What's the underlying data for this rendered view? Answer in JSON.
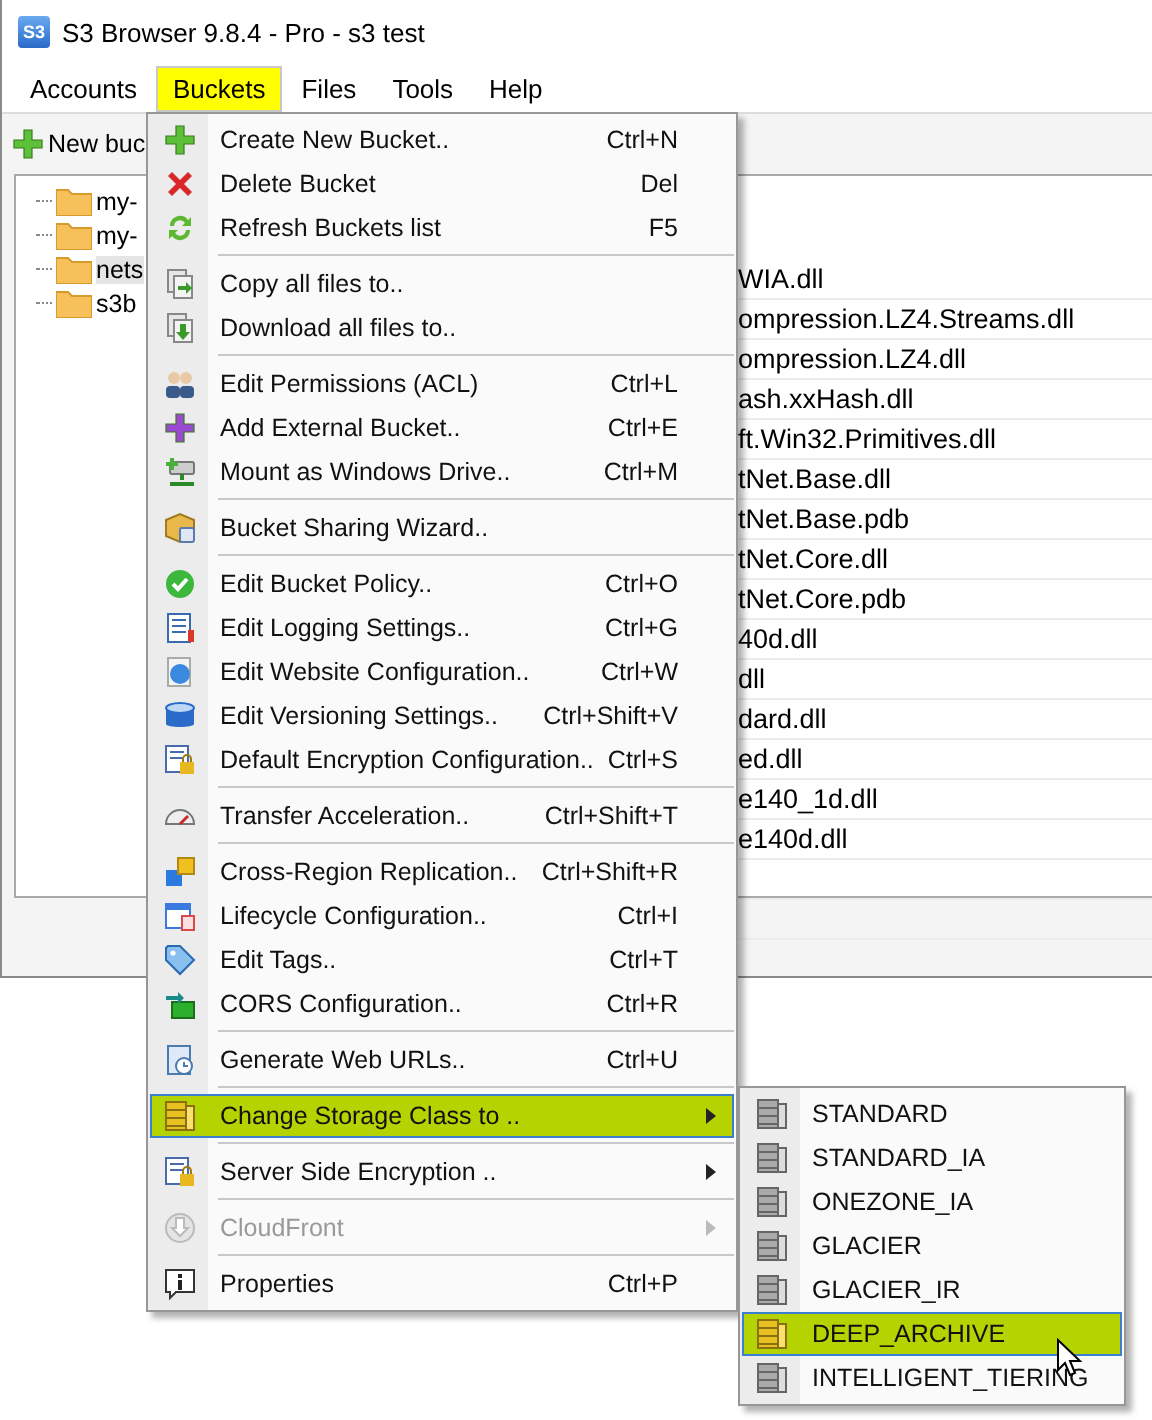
{
  "window": {
    "title": "S3 Browser 9.8.4 - Pro - s3 test",
    "app_icon_text": "S3"
  },
  "menu_bar": [
    {
      "label": "Accounts",
      "selected": false
    },
    {
      "label": "Buckets",
      "selected": true
    },
    {
      "label": "Files",
      "selected": false
    },
    {
      "label": "Tools",
      "selected": false
    },
    {
      "label": "Help",
      "selected": false
    }
  ],
  "toolbar": [
    {
      "label": "New buc"
    }
  ],
  "bucket_tree": [
    {
      "label": "my-",
      "selected": false
    },
    {
      "label": "my-",
      "selected": false
    },
    {
      "label": "nets",
      "selected": true
    },
    {
      "label": "s3b",
      "selected": false
    }
  ],
  "file_list": [
    "WIA.dll",
    "ompression.LZ4.Streams.dll",
    "ompression.LZ4.dll",
    "ash.xxHash.dll",
    "ft.Win32.Primitives.dll",
    "tNet.Base.dll",
    "tNet.Base.pdb",
    "tNet.Core.dll",
    "tNet.Core.pdb",
    "40d.dll",
    "dll",
    "dard.dll",
    "ed.dll",
    "e140_1d.dll",
    "e140d.dll"
  ],
  "buckets_menu": [
    {
      "kind": "item",
      "label": "Create New Bucket..",
      "shortcut": "Ctrl+N",
      "submenu": false,
      "disabled": false,
      "selected": false
    },
    {
      "kind": "item",
      "label": "Delete Bucket",
      "shortcut": "Del",
      "submenu": false,
      "disabled": false,
      "selected": false
    },
    {
      "kind": "item",
      "label": "Refresh Buckets list",
      "shortcut": "F5",
      "submenu": false,
      "disabled": false,
      "selected": false
    },
    {
      "kind": "separator"
    },
    {
      "kind": "item",
      "label": "Copy all files to..",
      "submenu": false,
      "disabled": false,
      "selected": false
    },
    {
      "kind": "item",
      "label": "Download all files to..",
      "submenu": false,
      "disabled": false,
      "selected": false
    },
    {
      "kind": "separator"
    },
    {
      "kind": "item",
      "label": "Edit Permissions (ACL)",
      "shortcut": "Ctrl+L",
      "submenu": false,
      "disabled": false,
      "selected": false
    },
    {
      "kind": "item",
      "label": "Add External Bucket..",
      "shortcut": "Ctrl+E",
      "submenu": false,
      "disabled": false,
      "selected": false
    },
    {
      "kind": "item",
      "label": "Mount as Windows Drive..",
      "shortcut": "Ctrl+M",
      "submenu": false,
      "disabled": false,
      "selected": false
    },
    {
      "kind": "separator"
    },
    {
      "kind": "item",
      "label": "Bucket Sharing Wizard..",
      "submenu": false,
      "disabled": false,
      "selected": false
    },
    {
      "kind": "separator"
    },
    {
      "kind": "item",
      "label": "Edit Bucket Policy..",
      "shortcut": "Ctrl+O",
      "submenu": false,
      "disabled": false,
      "selected": false
    },
    {
      "kind": "item",
      "label": "Edit Logging Settings..",
      "shortcut": "Ctrl+G",
      "submenu": false,
      "disabled": false,
      "selected": false
    },
    {
      "kind": "item",
      "label": "Edit Website Configuration..",
      "shortcut": "Ctrl+W",
      "submenu": false,
      "disabled": false,
      "selected": false
    },
    {
      "kind": "item",
      "label": "Edit Versioning Settings..",
      "shortcut": "Ctrl+Shift+V",
      "submenu": false,
      "disabled": false,
      "selected": false
    },
    {
      "kind": "item",
      "label": "Default Encryption Configuration..",
      "shortcut": "Ctrl+S",
      "submenu": false,
      "disabled": false,
      "selected": false
    },
    {
      "kind": "separator"
    },
    {
      "kind": "item",
      "label": "Transfer Acceleration..",
      "shortcut": "Ctrl+Shift+T",
      "submenu": false,
      "disabled": false,
      "selected": false
    },
    {
      "kind": "separator"
    },
    {
      "kind": "item",
      "label": "Cross-Region Replication..",
      "shortcut": "Ctrl+Shift+R",
      "submenu": false,
      "disabled": false,
      "selected": false
    },
    {
      "kind": "item",
      "label": "Lifecycle Configuration..",
      "shortcut": "Ctrl+I",
      "submenu": false,
      "disabled": false,
      "selected": false
    },
    {
      "kind": "item",
      "label": "Edit Tags..",
      "shortcut": "Ctrl+T",
      "submenu": false,
      "disabled": false,
      "selected": false
    },
    {
      "kind": "item",
      "label": "CORS Configuration..",
      "shortcut": "Ctrl+R",
      "submenu": false,
      "disabled": false,
      "selected": false
    },
    {
      "kind": "separator"
    },
    {
      "kind": "item",
      "label": "Generate Web URLs..",
      "shortcut": "Ctrl+U",
      "submenu": false,
      "disabled": false,
      "selected": false
    },
    {
      "kind": "separator"
    },
    {
      "kind": "item",
      "label": "Change Storage Class to ..",
      "submenu": true,
      "disabled": false,
      "selected": true
    },
    {
      "kind": "separator"
    },
    {
      "kind": "item",
      "label": "Server Side Encryption ..",
      "submenu": true,
      "disabled": false,
      "selected": false
    },
    {
      "kind": "separator"
    },
    {
      "kind": "item",
      "label": "CloudFront",
      "submenu": true,
      "disabled": true,
      "selected": false
    },
    {
      "kind": "separator"
    },
    {
      "kind": "item",
      "label": "Properties",
      "shortcut": "Ctrl+P",
      "submenu": false,
      "disabled": false,
      "selected": false
    }
  ],
  "storage_class_submenu": [
    {
      "label": "STANDARD",
      "selected": false
    },
    {
      "label": "STANDARD_IA",
      "selected": false
    },
    {
      "label": "ONEZONE_IA",
      "selected": false
    },
    {
      "label": "GLACIER",
      "selected": false
    },
    {
      "label": "GLACIER_IR",
      "selected": false
    },
    {
      "label": "DEEP_ARCHIVE",
      "selected": true
    },
    {
      "label": "INTELLIGENT_TIERING",
      "selected": false
    }
  ]
}
